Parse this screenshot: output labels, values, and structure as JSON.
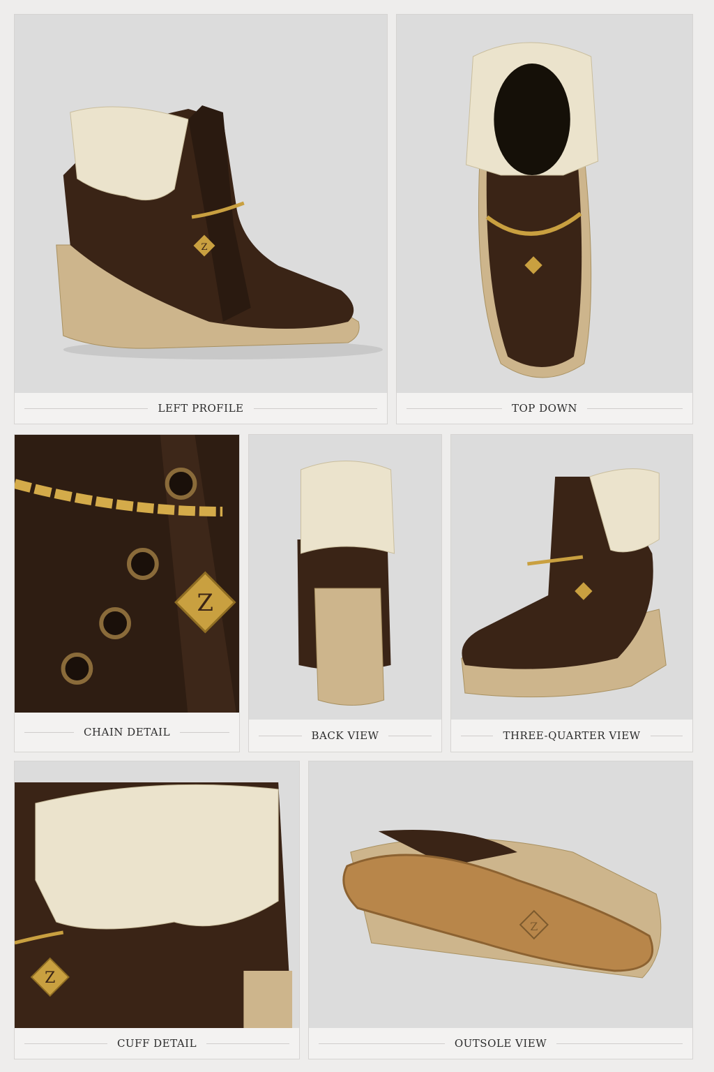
{
  "panels": [
    {
      "id": "left-profile",
      "caption": "LEFT PROFILE"
    },
    {
      "id": "top-down",
      "caption": "TOP DOWN"
    },
    {
      "id": "chain-detail",
      "caption": "CHAIN DETAIL"
    },
    {
      "id": "back-view",
      "caption": "BACK VIEW"
    },
    {
      "id": "three-quarter-view",
      "caption": "THREE-QUARTER VIEW"
    },
    {
      "id": "cuff-detail",
      "caption": "CUFF DETAIL"
    },
    {
      "id": "outsole-view",
      "caption": "OUTSOLE VIEW"
    }
  ],
  "charm_letter": "Z",
  "colors": {
    "leather": "#3a2416",
    "jute": "#cdb58c",
    "lace": "#ebe3cc",
    "gold": "#c9a040",
    "sole": "#b8864a"
  }
}
